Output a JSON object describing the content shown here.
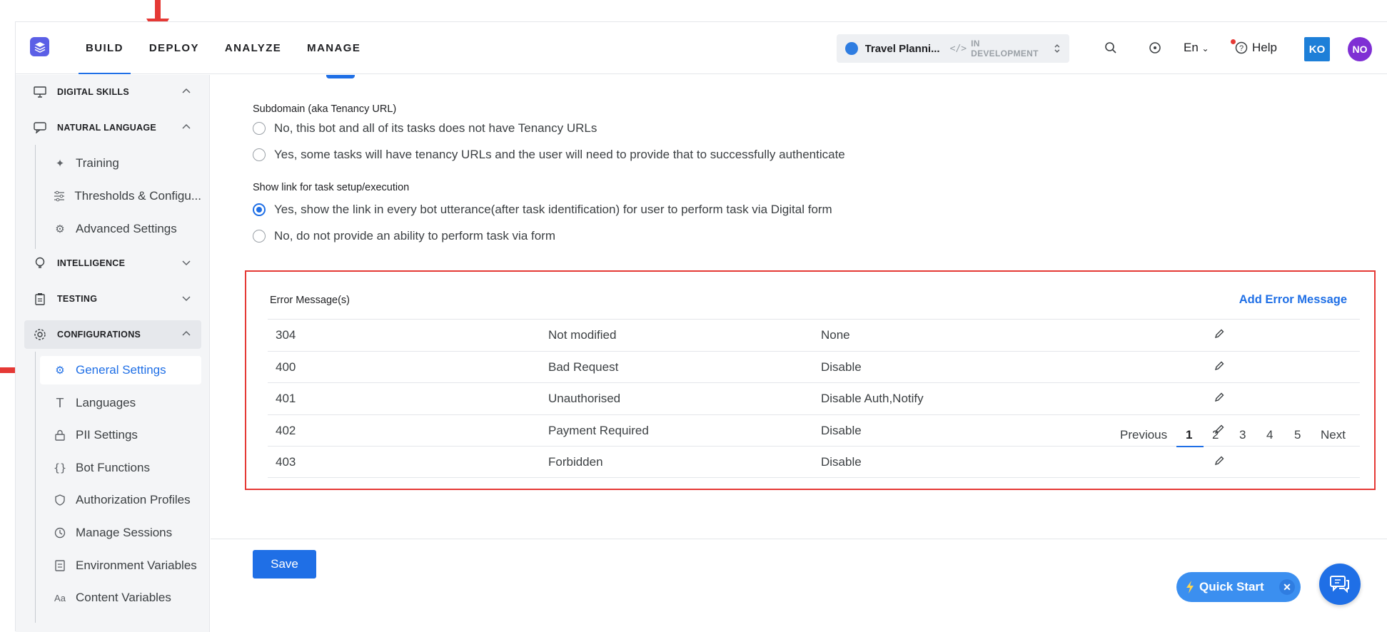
{
  "header": {
    "nav": [
      "BUILD",
      "DEPLOY",
      "ANALYZE",
      "MANAGE"
    ],
    "active_nav": "BUILD",
    "bot_name": "Travel Planni...",
    "bot_status": "IN DEVELOPMENT",
    "language": "En",
    "help_label": "Help",
    "user_initials_1": "KO",
    "user_initials_2": "NO"
  },
  "sidebar": {
    "sections": [
      {
        "label": "DIGITAL SKILLS",
        "icon": "monitor-icon",
        "expanded": true
      },
      {
        "label": "NATURAL LANGUAGE",
        "icon": "chat-icon",
        "expanded": true
      },
      {
        "label": "INTELLIGENCE",
        "icon": "bulb-icon",
        "expanded": false
      },
      {
        "label": "TESTING",
        "icon": "clipboard-icon",
        "expanded": false
      },
      {
        "label": "CONFIGURATIONS",
        "icon": "gear-icon",
        "expanded": true
      }
    ],
    "nl_items": [
      "Training",
      "Thresholds & Configu...",
      "Advanced Settings"
    ],
    "config_items": [
      "General Settings",
      "Languages",
      "PII Settings",
      "Bot Functions",
      "Authorization Profiles",
      "Manage Sessions",
      "Environment Variables",
      "Content Variables"
    ],
    "active_item": "General Settings"
  },
  "main": {
    "subdomain_label": "Subdomain (aka Tenancy URL)",
    "subdomain_options": [
      "No, this bot and all of its tasks does not have Tenancy URLs",
      "Yes, some tasks will have tenancy URLs and the user will need to provide that to successfully authenticate"
    ],
    "link_label": "Show link for task setup/execution",
    "link_options": [
      "Yes, show the link in every bot utterance(after task identification) for user to perform task via Digital form",
      "No, do not provide an ability to perform task via form"
    ],
    "link_selected": 0,
    "errors": {
      "title": "Error Message(s)",
      "add_label": "Add Error Message",
      "rows": [
        {
          "code": "304",
          "desc": "Not modified",
          "action": "None"
        },
        {
          "code": "400",
          "desc": "Bad Request",
          "action": "Disable"
        },
        {
          "code": "401",
          "desc": "Unauthorised",
          "action": "Disable Auth,Notify"
        },
        {
          "code": "402",
          "desc": "Payment Required",
          "action": "Disable"
        },
        {
          "code": "403",
          "desc": "Forbidden",
          "action": "Disable"
        }
      ]
    },
    "pager": {
      "previous": "Previous",
      "pages": [
        "1",
        "2",
        "3",
        "4",
        "5"
      ],
      "current": "1",
      "next": "Next"
    },
    "save_label": "Save"
  },
  "quick_start": "Quick Start",
  "colors": {
    "accent": "#1f6fe6",
    "highlight": "#e53935"
  }
}
